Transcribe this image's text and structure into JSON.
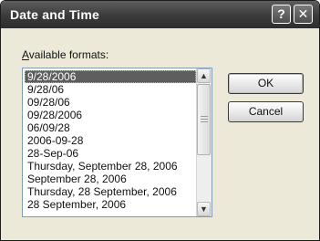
{
  "dialog": {
    "title": "Date and Time",
    "help_symbol": "?",
    "close_symbol": "✕"
  },
  "label": {
    "mnemonic": "A",
    "rest": "vailable formats:"
  },
  "formats": [
    "9/28/2006",
    "9/28/06",
    "09/28/06",
    "09/28/2006",
    "06/09/28",
    "2006-09-28",
    "28-Sep-06",
    "Thursday, September 28, 2006",
    "September 28, 2006",
    "Thursday, 28 September, 2006",
    "28 September, 2006"
  ],
  "selected_index": 0,
  "scrollbar": {
    "up_icon": "▲",
    "down_icon": "▼"
  },
  "buttons": {
    "ok": "OK",
    "cancel": "Cancel"
  }
}
